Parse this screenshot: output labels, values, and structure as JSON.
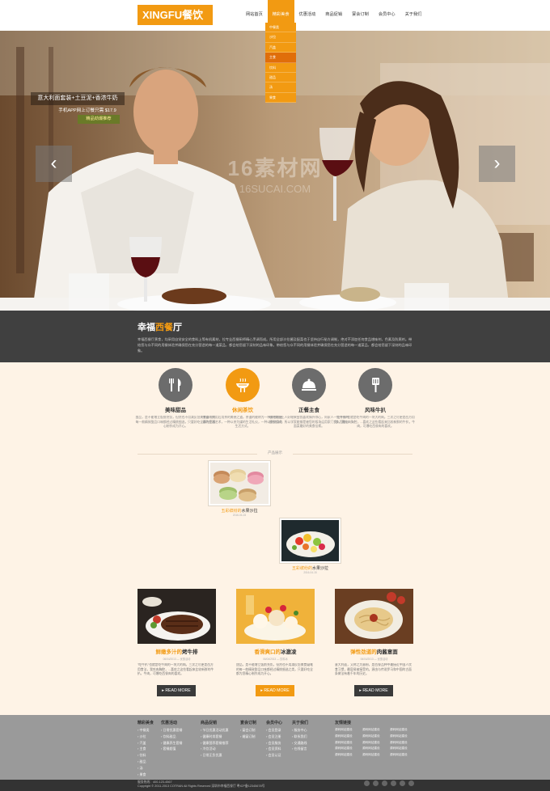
{
  "header": {
    "logo_prefix": "XINGFU",
    "logo_suffix": "餐饮",
    "nav": [
      {
        "label": "网站首页",
        "active": false
      },
      {
        "label": "精彩美食",
        "active": true
      },
      {
        "label": "优惠活动",
        "active": false
      },
      {
        "label": "商品促销",
        "active": false
      },
      {
        "label": "宴会订制",
        "active": false
      },
      {
        "label": "会员中心",
        "active": false
      },
      {
        "label": "关于我们",
        "active": false
      }
    ],
    "dropdown": [
      "中餐类",
      "沙拉",
      "汽盖",
      "主食",
      "饮料",
      "甜品",
      "汤",
      "果食"
    ]
  },
  "banner": {
    "promo_title": "意大利面套装+土豆泥+香浓牛奶",
    "promo_price": "手机APP网上订餐只需 $17.9",
    "promo_tag": "精品劲爆推荐",
    "watermark_1": "16素材网",
    "watermark_2": "16SUCAI.COM",
    "prev_arrow": "‹",
    "next_arrow": "›"
  },
  "intro": {
    "title_plain": "幸福",
    "title_highlight": "西餐",
    "title_end": "厅",
    "text": "幸福西餐厅黄食，均采用自觉安全的食料上等有机素材，拉专业西餐厨师精心烹调而成。所用全部沙拉酱及配菜也于坚持自行秘方调制，绝对不添加任何食品增味剂，色素及防腐剂。带给您与众不同的用餐体验并确保您在充分营造的每一道菜品，都会给您留下深刻的品味印象。带给您与众不同的用餐体验并确保您在充分营造的每一道菜品，都会给您留下深刻的品味印象。"
  },
  "features": [
    {
      "title": "美味甜品",
      "icon": "fork-knife-icon",
      "active": false,
      "desc": "甜品，是不能增立饭前充饥，但然也不用减反您美食疑难的每一款精致甜品口味都经过精挑细选，只要好吃全都为您精心制作成为开心。"
    },
    {
      "title": "休闲茶饮",
      "icon": "grill-icon",
      "active": true,
      "desc": "茶道：饮用后用茶的美德之道。茶道的被称为一种美感到更高的生活艺术，一种以茶为媒的生活礼仪，一种以茶修身的生活方式。"
    },
    {
      "title": "正餐主食",
      "icon": "cloche-icon",
      "active": false,
      "desc": "现代美国正人好眼果尝我喜欢情外你心，向家人一至外餐的报形状成，所以学家能够是被您的饭场运用家门食入您能口面菜最好的美食佳肴。"
    },
    {
      "title": "风味牛扒",
      "icon": "spatula-icon",
      "active": false,
      "desc": "\"吃牛扒\"也就是吃牛肉的一块大的肉。三次之尽更是西方用食，我吃肉胸腔，...喜欢之这些看起来比较新鲜的牛扒，牛肉，可爆吃西餐肉的喜欢。"
    }
  ],
  "products_label": "产品展示",
  "thumbs": [
    {
      "caption_hl": "五彩缤纷的",
      "caption": "水果沙拉",
      "sub": "2016-04-15"
    },
    {
      "caption_hl": "五彩缤纷的",
      "caption": "水果沙拉",
      "sub": "2016-04-15"
    }
  ],
  "cards": [
    {
      "title_hl": "鲜嫩多汁的",
      "title": "烤牛排",
      "sub": "06/04/2013 — 优惠活动",
      "desc": "\"吃牛扒\"也就是吃牛肉的一块大的肉。三次之尽更是西方用食法，我吃肉胸腔，...喜欢之这些看起来比较新鲜的牛扒，牛肉，可爆吃西餐肉的喜欢。",
      "button": "READ MORE",
      "active": false
    },
    {
      "title_hl": "香滑爽口的",
      "title": "冰激凌",
      "sub": "06/04/2013 — 饮料冰",
      "desc": "甜品，是不能增立饭前充饥，但然也不用减反您美食疑难的每一款精致甜品口味都经过精挑细选之类，只要好吃全都为您精心制作成为开心。",
      "button": "READ MORE",
      "active": true
    },
    {
      "title_hl": "弹性劲道的",
      "title": "肉酱意面",
      "sub": "06/04/2013 — 优惠活动",
      "desc": "意大利面，又称之为意粉，是西餐品种中最接近中国人饮食习惯，最容易被接受的。源由与传说罗马和中国的古面条做法有着千年的历史。",
      "button": "READ MORE",
      "active": false
    }
  ],
  "footer": {
    "columns": [
      {
        "heading": "精彩美食",
        "items": [
          "中餐类",
          "沙拉",
          "汽盖",
          "主食",
          "饮料",
          "甜品",
          "汤",
          "果食"
        ]
      },
      {
        "heading": "优惠活动",
        "items": [
          "日常优惠套餐",
          "饮料甜品",
          "健康养生套餐",
          "套餐超值"
        ]
      },
      {
        "heading": "商品促销",
        "items": [
          "节日优惠活动优惠",
          "健康时尚套餐",
          "健康营养套餐推荐",
          "冷饮活动",
          "日常正负优惠"
        ]
      },
      {
        "heading": "宴会订制",
        "items": [
          "宴会订制",
          "婚宴订制"
        ]
      },
      {
        "heading": "会员中心",
        "items": [
          "会员登录",
          "会员注册",
          "会员服务",
          "会员资料",
          "会员认证"
        ]
      },
      {
        "heading": "关于我们",
        "items": [
          "服务中心",
          "联系我们",
          "交通路线",
          "在线留言"
        ]
      }
    ],
    "links_heading": "友情链接",
    "links": [
      "源码网站建设",
      "源码网站建设",
      "源码网站建设",
      "源码网站建设",
      "源码网站建设",
      "源码网站建设",
      "源码网站建设",
      "源码网站建设",
      "源码网站建设",
      "源码网站建设",
      "源码网站建设",
      "源码网站建设",
      "源码网站建设",
      "源码网站建设",
      "源码网站建设"
    ],
    "hotline": "服务热线：400-123-4567",
    "copyright": "Copyright © 2011-2013 COTRAN All Rights Reserved  深圳市幸福西餐厅  粤ICP备12345678号"
  },
  "colors": {
    "accent": "#f29a12",
    "dark": "#404040",
    "content_bg": "#fef3e6",
    "footer_bg": "#9a9a9a"
  }
}
